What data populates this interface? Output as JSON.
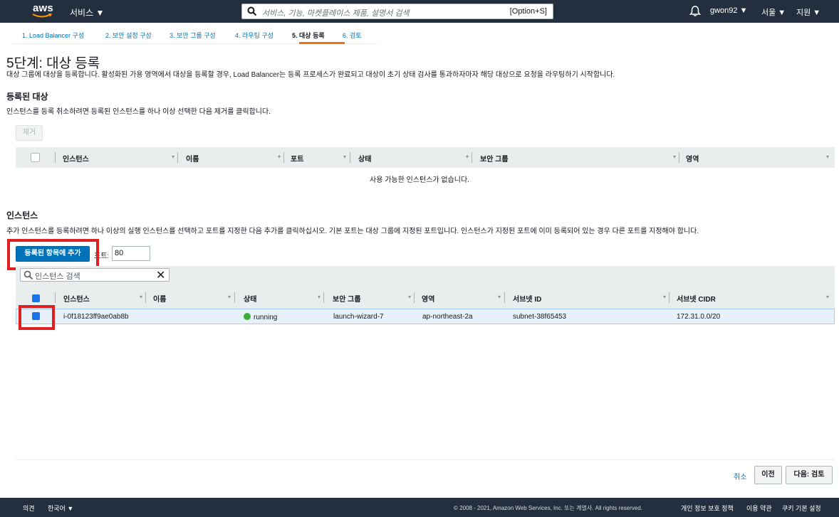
{
  "nav": {
    "logo": "aws",
    "services": "서비스 ▼",
    "search_placeholder": "서비스, 기능, 마켓플레이스 제품, 설명서 검색",
    "search_shortcut": "[Option+S]",
    "user": "gwon92 ▼",
    "region": "서울 ▼",
    "support": "지원 ▼"
  },
  "tabs": [
    {
      "label": "1. Load Balancer 구성",
      "active": false
    },
    {
      "label": "2. 보안 설정 구성",
      "active": false
    },
    {
      "label": "3. 보안 그룹 구성",
      "active": false
    },
    {
      "label": "4. 라우팅 구성",
      "active": false
    },
    {
      "label": "5. 대상 등록",
      "active": true
    },
    {
      "label": "6. 검토",
      "active": false
    }
  ],
  "page": {
    "title": "5단계: 대상 등록",
    "description": "대상 그룹에 대상을 등록합니다. 활성화된 가용 영역에서 대상을 등록할 경우, Load Balancer는 등록 프로세스가 완료되고 대상이 초기 상태 검사를 통과하자마자 해당 대상으로 요청을 라우팅하기 시작합니다."
  },
  "registered": {
    "heading": "등록된 대상",
    "desc": "인스턴스를 등록 취소하려면 등록된 인스턴스를 하나 이상 선택한 다음 제거를 클릭합니다.",
    "remove_button": "제거",
    "columns": [
      "인스턴스",
      "이름",
      "포트",
      "상태",
      "보안 그룹",
      "영역"
    ],
    "empty_message": "사용 가능한 인스턴스가 없습니다."
  },
  "instances": {
    "heading": "인스턴스",
    "desc": "추가 인스턴스를 등록하려면 하나 이상의 실행 인스턴스를 선택하고 포트를 지정한 다음 추가를 클릭하십시오. 기본 포트는 대상 그룹에 지정된 포트입니다. 인스턴스가 지정된 포트에 이미 등록되어 있는 경우 다른 포트를 지정해야 합니다.",
    "add_button": "등록된 항목에 추가",
    "port_label": "포트:",
    "port_value": "80",
    "filter_placeholder": "인스턴스 검색",
    "columns": [
      "인스턴스",
      "이름",
      "상태",
      "보안 그룹",
      "영역",
      "서브넷 ID",
      "서브넷 CIDR"
    ],
    "rows": [
      {
        "instance": "i-0f18123ff9ae0ab8b",
        "name": "",
        "state": "running",
        "security_group": "launch-wizard-7",
        "zone": "ap-northeast-2a",
        "subnet_id": "subnet-38f65453",
        "subnet_cidr": "172.31.0.0/20",
        "selected": true
      }
    ]
  },
  "actions": {
    "cancel": "취소",
    "previous": "이전",
    "next": "다음: 검토"
  },
  "footer": {
    "feedback": "의견",
    "language": "한국어 ▼",
    "copyright": "© 2008 - 2021, Amazon Web Services, Inc. 또는 계열사. All rights reserved.",
    "privacy": "개인 정보 보호 정책",
    "terms": "이용 약관",
    "cookies": "쿠키 기본 설정"
  },
  "colors": {
    "nav_bg": "#232f3e",
    "accent_orange": "#ec7211",
    "primary_blue": "#0073bb",
    "highlight_red": "#e02020",
    "running_green": "#3ab03a"
  }
}
